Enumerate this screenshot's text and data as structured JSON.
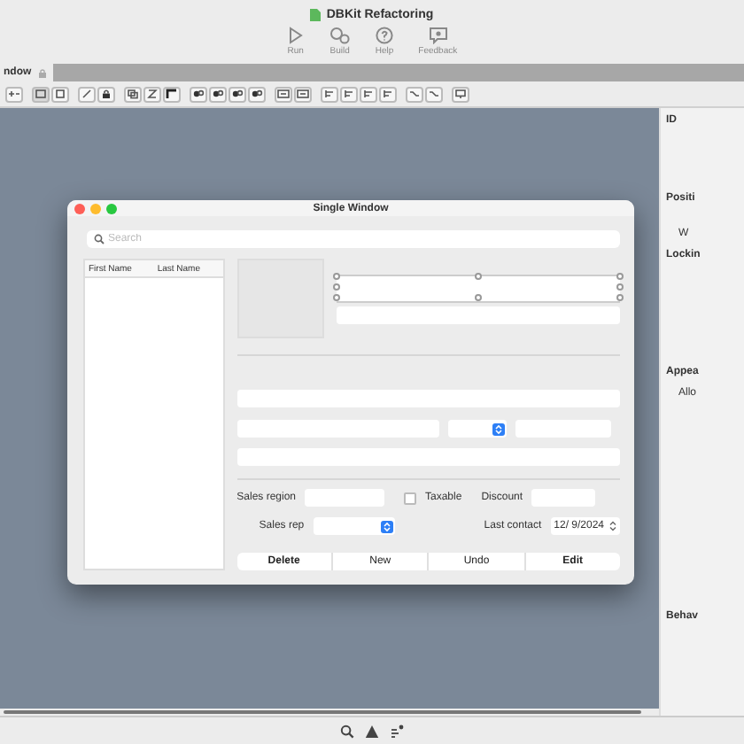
{
  "window": {
    "title": "DBKit Refactoring"
  },
  "toolbar": [
    {
      "label": "Run",
      "kind": "run"
    },
    {
      "label": "Build",
      "kind": "build"
    },
    {
      "label": "Help",
      "kind": "help"
    },
    {
      "label": "Feedback",
      "kind": "feedback"
    }
  ],
  "tab": {
    "label": "ndow",
    "locked": true
  },
  "design_window": {
    "title": "Single Window",
    "search": {
      "placeholder": "Search"
    },
    "table": {
      "columns": [
        "First Name",
        "Last Name"
      ]
    },
    "form": {
      "sales_region_label": "Sales region",
      "taxable": {
        "label": "Taxable",
        "checked": false
      },
      "discount_label": "Discount",
      "sales_rep_label": "Sales rep",
      "last_contact_label": "Last contact",
      "last_contact_value": "12/ 9/2024"
    },
    "buttons": [
      "Delete",
      "New",
      "Undo",
      "Edit"
    ]
  },
  "inspector": {
    "sections": [
      {
        "label": "ID",
        "kind": "heading"
      },
      {
        "label": "Positi",
        "kind": "heading"
      },
      {
        "label": "W",
        "kind": "field"
      },
      {
        "label": "Lockin",
        "kind": "heading"
      },
      {
        "label": "Appea",
        "kind": "heading"
      },
      {
        "label": "Allo",
        "kind": "field"
      },
      {
        "label": "Behav",
        "kind": "heading"
      }
    ]
  }
}
